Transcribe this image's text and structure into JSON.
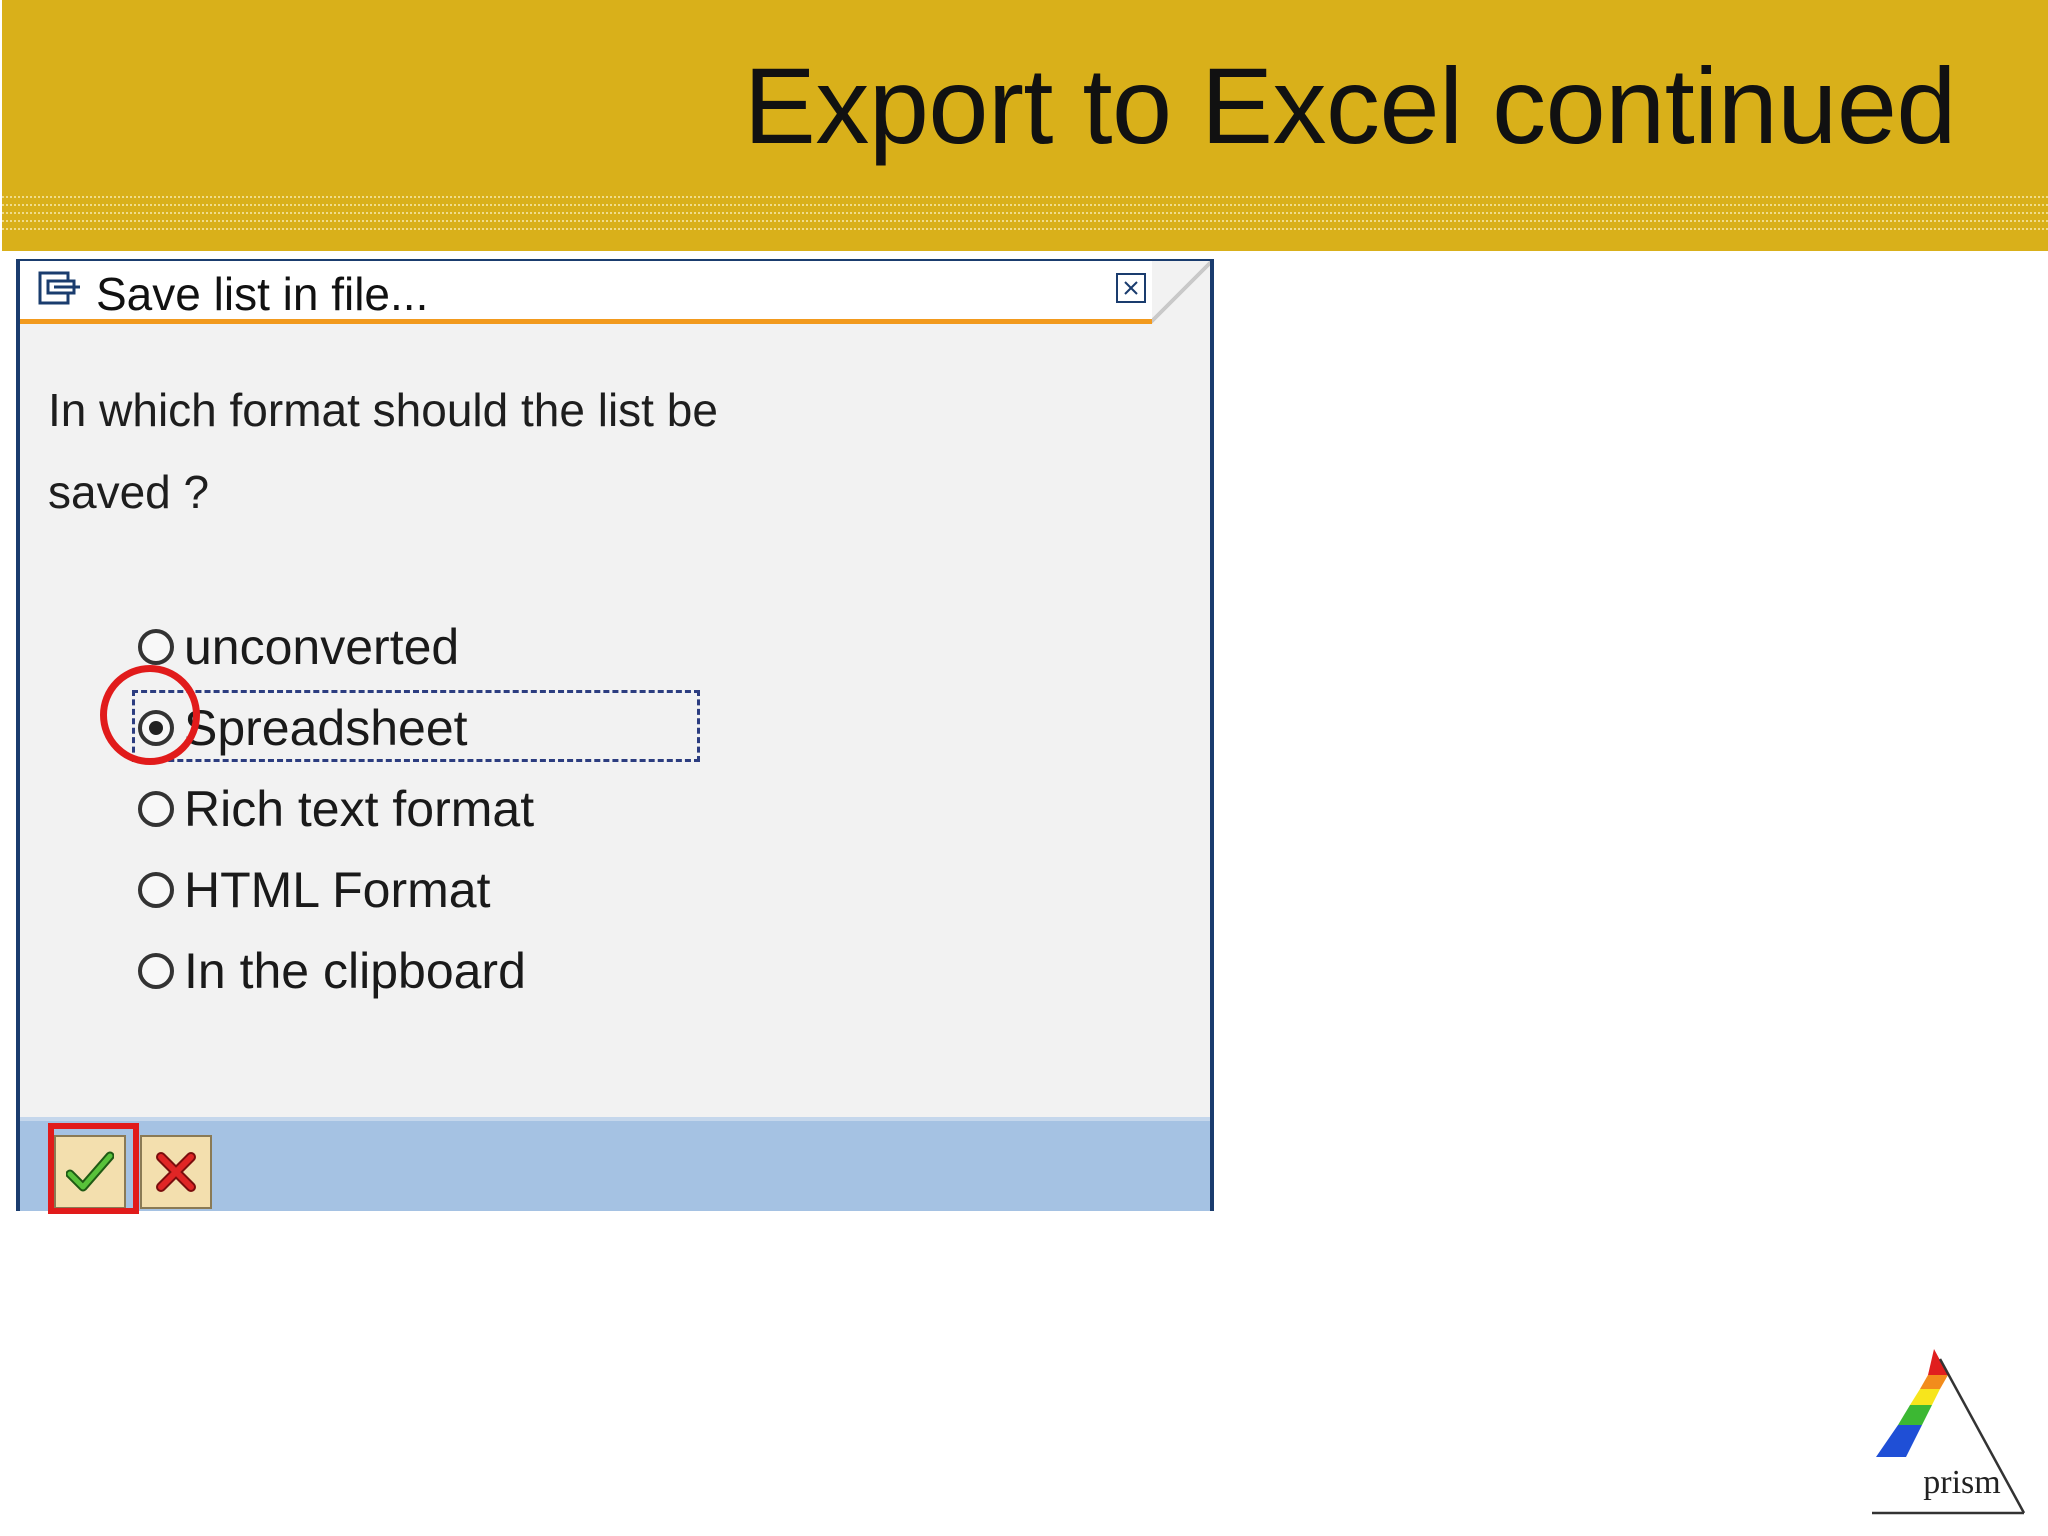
{
  "slide": {
    "title": "Export to Excel continued"
  },
  "dialog": {
    "title": "Save list in file...",
    "question": "In which format should the list be saved ?",
    "options": [
      {
        "label": "unconverted",
        "selected": false
      },
      {
        "label": "Spreadsheet",
        "selected": true
      },
      {
        "label": "Rich text format",
        "selected": false
      },
      {
        "label": "HTML Format",
        "selected": false
      },
      {
        "label": "In the clipboard",
        "selected": false
      }
    ],
    "buttons": {
      "confirm_icon": "checkmark-icon",
      "cancel_icon": "cancel-x-icon"
    }
  },
  "logo": {
    "text": "prism"
  },
  "colors": {
    "header_band": "#d9b01a",
    "titlebar_accent": "#f29a1e",
    "footer_bar": "#a5c2e3",
    "annotation": "#e11b1b"
  }
}
